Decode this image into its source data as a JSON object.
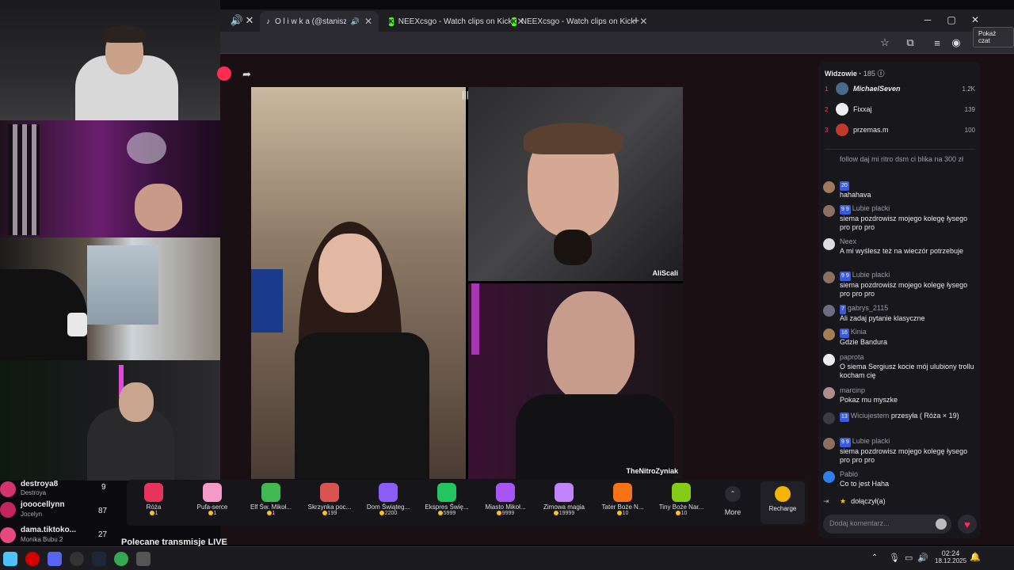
{
  "tabs": [
    {
      "label": "O l i w k a (@staniszesia_) p",
      "active": true
    },
    {
      "label": "NEEXcsgo - Watch clips on Kick"
    },
    {
      "label": "NEEXcsgo - Watch clips on Kick"
    }
  ],
  "tooltip": "Pokaż czat",
  "stage": {
    "cams": [
      {
        "label": ""
      },
      {
        "label": "AliScali"
      },
      {
        "label": "TheNitroZyniak"
      }
    ]
  },
  "chat": {
    "viewers_title": "Widzowie",
    "viewers_count": "185",
    "top_viewers": [
      {
        "rank": "1",
        "name": "MichaelSeven",
        "count": "1.2K"
      },
      {
        "rank": "2",
        "name": "Fixxaj",
        "count": "139"
      },
      {
        "rank": "3",
        "name": "przemas.m",
        "count": "100"
      }
    ],
    "messages": [
      {
        "user": "",
        "text": "follow daj mi ritro dsm ci blika na 300 zł"
      },
      {
        "badges": "20",
        "user": "",
        "text": "hahahava"
      },
      {
        "badges": "9 9",
        "user": "Lubie placki",
        "text": "siema pozdrowisz mojego kolegę łysego pro pro pro"
      },
      {
        "user": "Neex",
        "text": "A mi wyślesz też na wieczór potrzebuje"
      },
      {
        "badges": "9 9",
        "user": "Lubie placki",
        "text": "siema pozdrowisz mojego kolegę łysego pro pro pro"
      },
      {
        "badges": "7",
        "user": "gabrys_2115",
        "text": "Ali zadaj pytanie klasyczne"
      },
      {
        "badges": "16",
        "user": "Kinia",
        "text": "Gdzie Bandura"
      },
      {
        "user": "paprota",
        "text": "O siema Sergiusz kocie mój ulubiony trollu kocham cię"
      },
      {
        "user": "marcinp",
        "text": "Pokaz mu myszke"
      },
      {
        "badges": "13",
        "user": "Wiciujestem",
        "text": "przesyła ( Róża × 19)"
      },
      {
        "badges": "9 9",
        "user": "Lubie placki",
        "text": "siema pozdrowisz mojego kolegę łysego pro pro pro"
      },
      {
        "user": "Pablo",
        "text": "Co to jest Haha"
      }
    ],
    "joined": "dołączył(a)",
    "input_placeholder": "Dodaj komentarz..."
  },
  "gifts": [
    {
      "name": "Róża",
      "price": "1",
      "color": "#e8335a"
    },
    {
      "name": "Pufa-serce",
      "price": "1",
      "color": "#f59ac8"
    },
    {
      "name": "Elf Św. Mikoł...",
      "price": "1",
      "color": "#3fb950"
    },
    {
      "name": "Skrzynka poc...",
      "price": "199",
      "color": "#d9534f"
    },
    {
      "name": "Dom Świąteg...",
      "price": "2200",
      "color": "#8b5cf6"
    },
    {
      "name": "Ekspres Świę...",
      "price": "5999",
      "color": "#22c55e"
    },
    {
      "name": "Miasto Mikoł...",
      "price": "9999",
      "color": "#a855f7"
    },
    {
      "name": "Zimowa magia",
      "price": "19999",
      "color": "#c084fc"
    },
    {
      "name": "Tater Boże N...",
      "price": "10",
      "color": "#f97316"
    },
    {
      "name": "Tiny Boże Nar...",
      "price": "10",
      "color": "#84cc16"
    }
  ],
  "more_label": "More",
  "recharge_label": "Recharge",
  "leaderboard": [
    {
      "name": "destroya8",
      "sub": "Destroya",
      "score": "9"
    },
    {
      "name": "jooocellynn",
      "sub": "Jocelyn",
      "score": "87"
    },
    {
      "name": "dama.tiktoko...",
      "sub": "Monika Bubu 2",
      "score": "27"
    }
  ],
  "recommended": "Polecane transmisje LIVE",
  "taskbar": {
    "time": "02:24",
    "date": "18.12.2025"
  }
}
